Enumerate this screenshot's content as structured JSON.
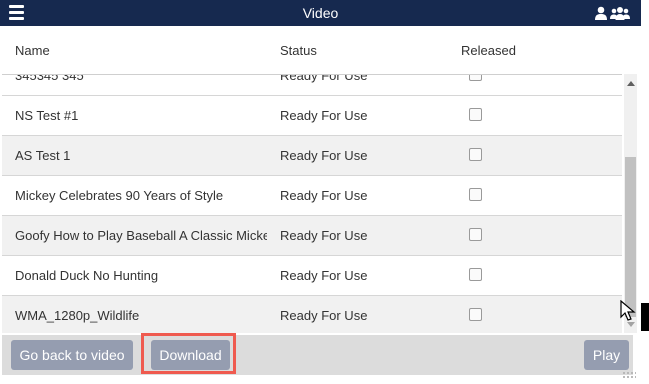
{
  "header": {
    "title": "Video",
    "menu_icon": "hamburger-icon",
    "right_icons": [
      "user-icon",
      "group-icon"
    ],
    "background_color": "#16294f"
  },
  "table": {
    "columns": [
      "Name",
      "Status",
      "Released"
    ],
    "rows": [
      {
        "name": "345345 345",
        "status": "Ready For Use",
        "released": false
      },
      {
        "name": "NS Test #1",
        "status": "Ready For Use",
        "released": false
      },
      {
        "name": "AS Test 1",
        "status": "Ready For Use",
        "released": false
      },
      {
        "name": "Mickey Celebrates 90 Years of Style",
        "status": "Ready For Use",
        "released": false
      },
      {
        "name": "Goofy How to Play Baseball A Classic Mickey Cartoon",
        "status": "Ready For Use",
        "released": false
      },
      {
        "name": "Donald Duck No Hunting",
        "status": "Ready For Use",
        "released": false
      },
      {
        "name": "WMA_1280p_Wildlife",
        "status": "Ready For Use",
        "released": false
      }
    ]
  },
  "footer": {
    "back_label": "Go back to video",
    "download_label": "Download",
    "play_label": "Play",
    "button_color": "#959db0",
    "highlight_color": "#ef5a4f"
  }
}
